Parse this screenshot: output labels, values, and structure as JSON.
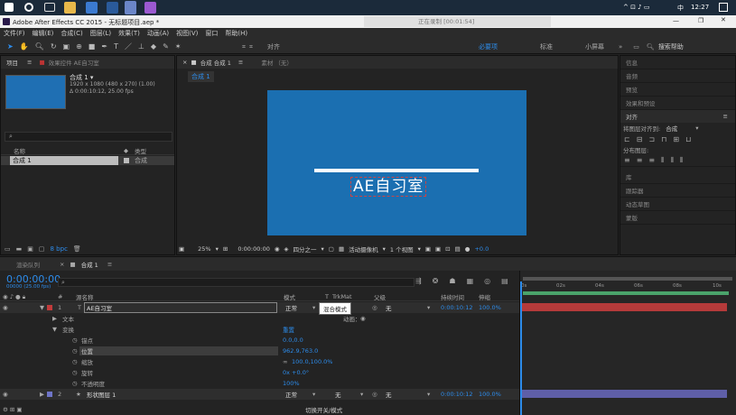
{
  "taskbar": {
    "notice_text": "正在录制 [00:01:54]",
    "clock": "12:27",
    "ime": "中",
    "tray": "^ ⊡ ♪ ▭"
  },
  "window": {
    "title": "Adobe After Effects CC 2015 - 无标题项目.aep *"
  },
  "menu": [
    "文件(F)",
    "编辑(E)",
    "合成(C)",
    "图层(L)",
    "效果(T)",
    "动画(A)",
    "视图(V)",
    "窗口",
    "帮助(H)"
  ],
  "toolbar": {
    "align_label": "对齐",
    "workspaces": [
      "必要项",
      "标准",
      "小屏幕"
    ],
    "search_help": "搜索帮助"
  },
  "project": {
    "tab": "项目",
    "effects_tab": "效果控件 AE自习室",
    "comp_name": "合成 1 ▾",
    "comp_info1": "1920 x 1080 (480 x 270) (1.00)",
    "comp_info2": "Δ 0:00:10:12, 25.00 fps",
    "col_name": "名称",
    "col_type": "类型",
    "item_name": "合成 1",
    "item_type": "合成",
    "bpc": "8 bpc"
  },
  "viewer": {
    "tab": "合成 合成 1",
    "footage_tab": "素材 （无）",
    "comp_chip": "合成 1",
    "canvas_text": "AE自习室",
    "zoom": "25%",
    "timecode": "0:00:00:00",
    "quality": "四分之一",
    "camera": "活动摄像机",
    "views": "1 个视图",
    "exposure": "+0.0"
  },
  "right_panels": {
    "items": [
      "信息",
      "音频",
      "预览",
      "效果和预设"
    ],
    "align": "对齐",
    "align_to_label": "将图层对齐到:",
    "align_to_value": "合成",
    "distribute": "分布图层:",
    "lower": [
      "库",
      "跟踪器",
      "动态草图",
      "蒙版"
    ]
  },
  "timeline": {
    "tab_render": "渲染队列",
    "tab_comp": "合成 1",
    "timecode": "0:00:00:00",
    "fps": "00000 (25.00 fps)",
    "col_num": "#",
    "col_source": "源名称",
    "col_mode": "模式",
    "col_t": "T",
    "col_trkmat": "TrkMat",
    "col_parent": "父级",
    "col_dur": "持续时间",
    "col_stretch": "伸缩",
    "tooltip": "混合模式",
    "footer": "切换开关/模式",
    "ruler": [
      "0s",
      "02s",
      "04s",
      "06s",
      "08s",
      "10s"
    ],
    "layers": [
      {
        "num": "1",
        "name": "AE自习室",
        "mode": "正常",
        "parent": "无",
        "dur": "0:00:10:12",
        "stretch": "100.0%"
      },
      {
        "num": "2",
        "name": "形状图层 1",
        "mode": "正常",
        "trkmat": "无",
        "parent": "无",
        "dur": "0:00:10:12",
        "stretch": "100.0%"
      }
    ],
    "text_group": "文本",
    "anim_label": "动画：",
    "transform_group": "变换",
    "reset": "重置",
    "props": [
      {
        "name": "锚点",
        "value": "0.0,0.0"
      },
      {
        "name": "位置",
        "value": "962.9,763.0"
      },
      {
        "name": "缩放",
        "value": "100.0,100.0%"
      },
      {
        "name": "旋转",
        "value": "0x +0.0°"
      },
      {
        "name": "不透明度",
        "value": "100%"
      }
    ]
  }
}
